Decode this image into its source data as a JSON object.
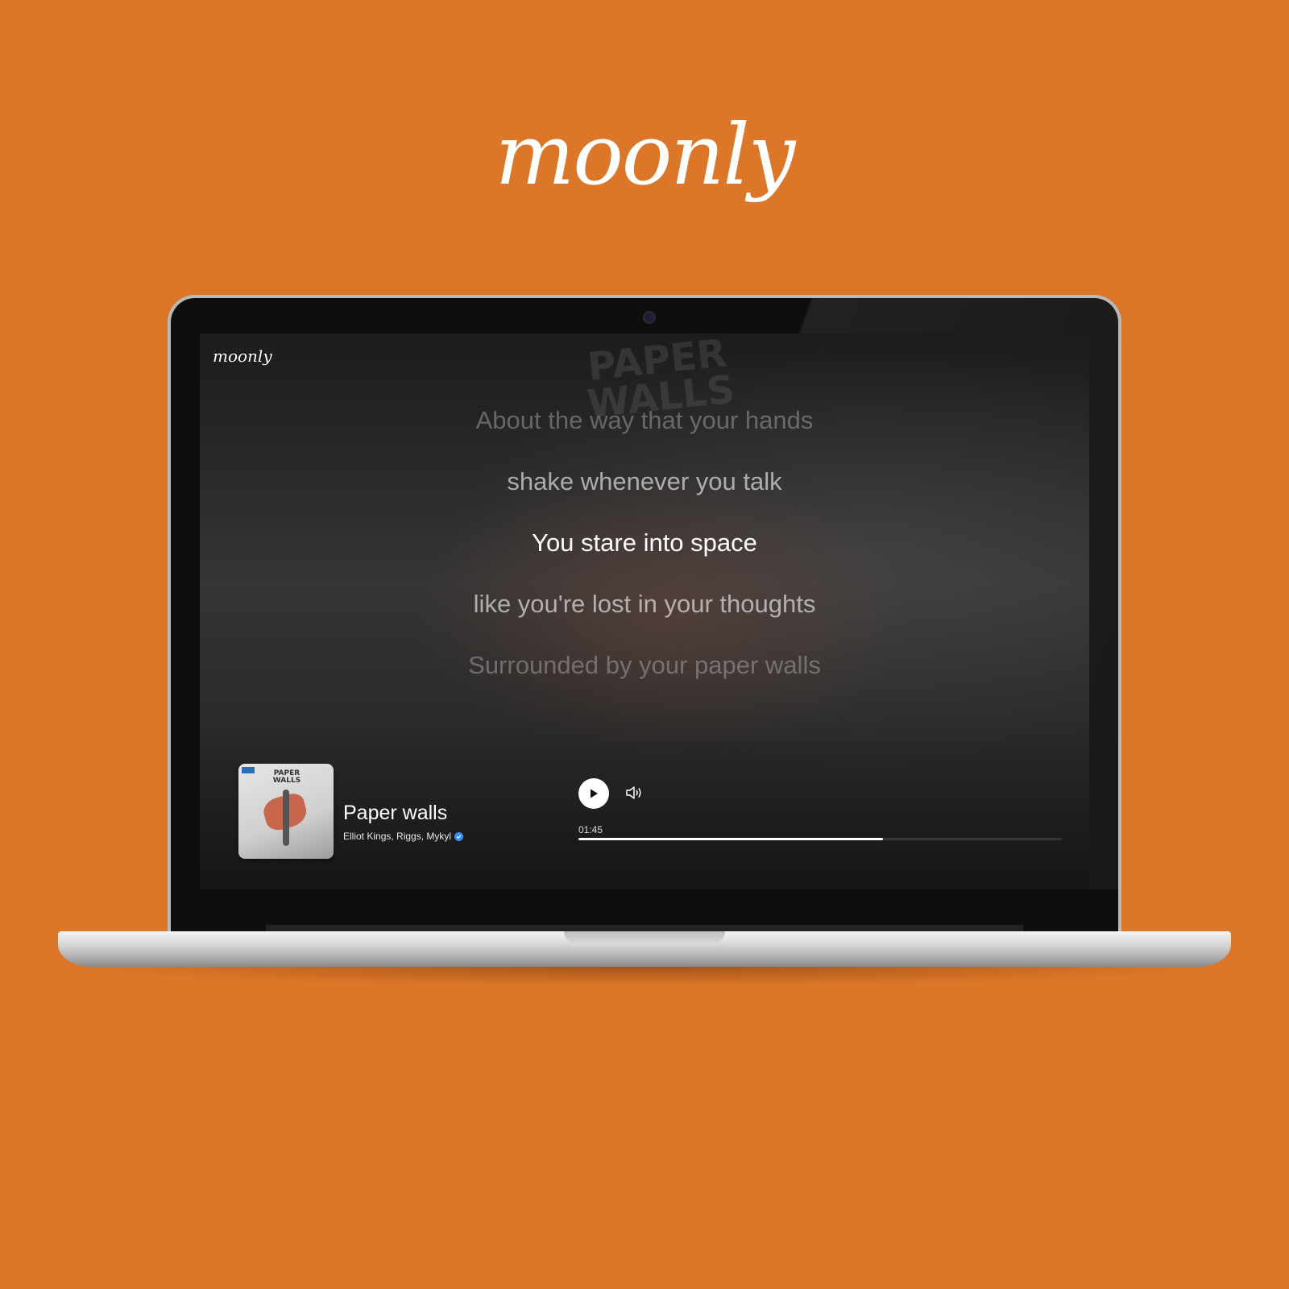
{
  "brand": {
    "logo_text": "moonly"
  },
  "app": {
    "logo_text": "moonly",
    "artwork_watermark": "PAPER WALLS"
  },
  "lyrics": {
    "lines": [
      {
        "text": "About the way that your hands",
        "state": "far"
      },
      {
        "text": "shake whenever you talk",
        "state": "near"
      },
      {
        "text": "You stare into space",
        "state": "current"
      },
      {
        "text": "like you're lost in your thoughts",
        "state": "near"
      },
      {
        "text": "Surrounded by your paper walls",
        "state": "far"
      }
    ]
  },
  "player": {
    "track_title": "Paper walls",
    "artists": "Elliot Kings, Riggs, Mykyl",
    "artist_verified": true,
    "album_art_title": "PAPER WALLS",
    "elapsed": "01:45",
    "progress_fraction": 0.63,
    "play_icon": "play-icon",
    "volume_icon": "volume-icon"
  },
  "colors": {
    "background": "#dc7729",
    "accent": "#ffffff",
    "verified": "#3b8cf5"
  }
}
